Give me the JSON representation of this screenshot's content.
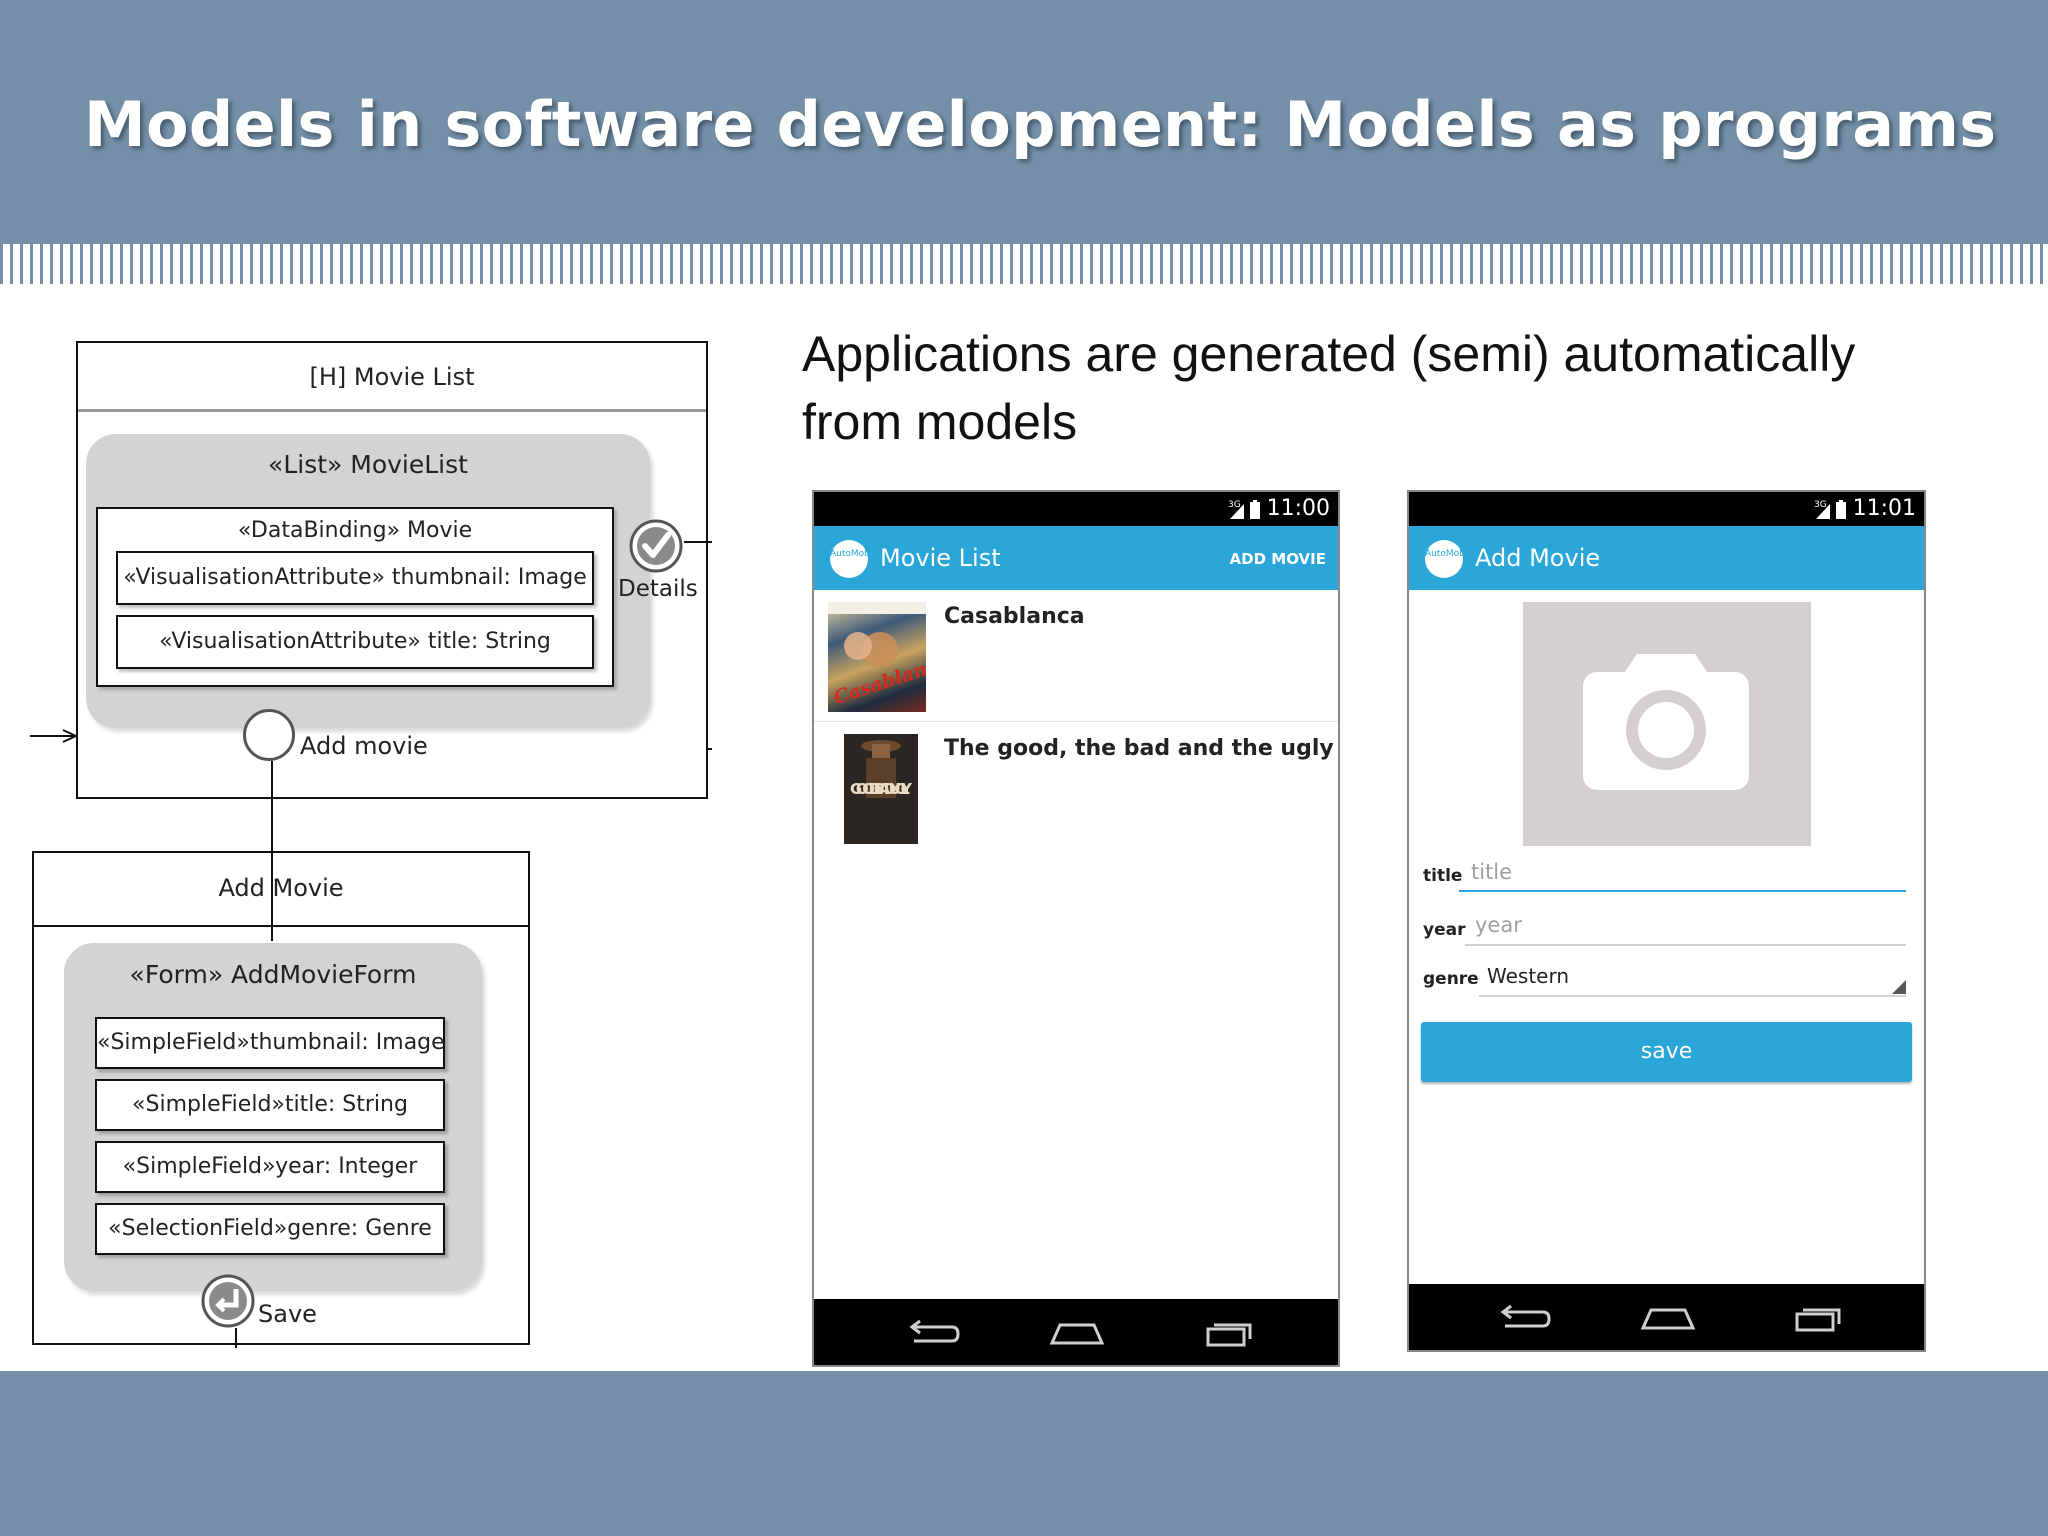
{
  "slide": {
    "title": "Models in software development: Models as programs",
    "heading_line1": "Applications are generated (semi) automatically",
    "heading_line2": "from models"
  },
  "diagram": {
    "frame1_title": "[H] Movie List",
    "list_label": "«List» MovieList",
    "binding_label": "«DataBinding»  Movie",
    "attr1": "«VisualisationAttribute»  thumbnail: Image",
    "attr2": "«VisualisationAttribute»  title: String",
    "details_label": "Details",
    "add_movie_label": "Add movie",
    "frame2_title": "Add Movie",
    "form_label": "«Form» AddMovieForm",
    "field1": "«SimpleField»thumbnail: Image",
    "field2": "«SimpleField»title: String",
    "field3": "«SimpleField»year: Integer",
    "field4": "«SelectionField»genre: Genre",
    "save_label": "Save"
  },
  "phone1": {
    "time": "11:00",
    "network": "3G",
    "logo": "AutoMobile",
    "title": "Movie List",
    "action": "ADD MOVIE",
    "movies": [
      {
        "title": "Casablanca",
        "poster_text": "Casablanca"
      },
      {
        "title": "The good, the bad and the ugly",
        "poster_text": "GOOD BAD UGLY"
      }
    ]
  },
  "phone2": {
    "time": "11:01",
    "network": "3G",
    "logo": "AutoMobile",
    "title": "Add Movie",
    "photo_icon": "camera-icon",
    "fields": {
      "title_label": "title",
      "title_placeholder": "title",
      "year_label": "year",
      "year_placeholder": "year",
      "genre_label": "genre",
      "genre_value": "Western"
    },
    "save_button": "save"
  },
  "colors": {
    "band": "#7590a8",
    "app_bar": "#2aa7d8",
    "diagram_gray": "#d4d2d4"
  }
}
